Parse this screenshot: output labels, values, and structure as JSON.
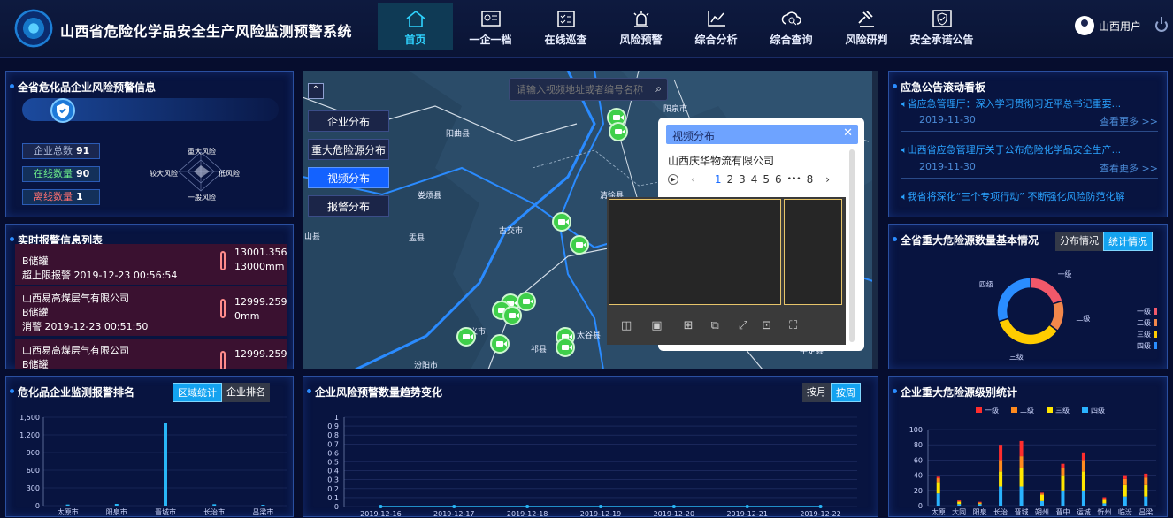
{
  "header": {
    "title": "山西省危险化学品安全生产风险监测预警系统",
    "user": "山西用户",
    "nav": [
      {
        "label": "首页"
      },
      {
        "label": "一企一档"
      },
      {
        "label": "在线巡查"
      },
      {
        "label": "风险预警"
      },
      {
        "label": "综合分析"
      },
      {
        "label": "综合查询"
      },
      {
        "label": "风险研判"
      },
      {
        "label": "安全承诺公告"
      }
    ]
  },
  "risk_panel": {
    "title": "全省危化品企业风险预警信息",
    "total_label": "企业总数",
    "total": "91",
    "online_label": "在线数量",
    "online": "90",
    "offline_label": "离线数量",
    "offline": "1",
    "radar": {
      "top": "重大风险",
      "right": "低风险",
      "bottom": "一般风险",
      "left": "较大风险"
    }
  },
  "alarm_panel": {
    "title": "实时报警信息列表",
    "rows": [
      {
        "company": "",
        "tank": "B储罐",
        "status": "超上限报警 2019-12-23 00:56:54",
        "value1": "13001.356",
        "value2": "13000mm"
      },
      {
        "company": "山西易高煤层气有限公司",
        "tank": "B储罐",
        "status": "消警 2019-12-23 00:51:50",
        "value1": "12999.259",
        "value2": "0mm"
      },
      {
        "company": "山西易高煤层气有限公司",
        "tank": "B储罐",
        "status": "",
        "value1": "12999.259",
        "value2": ""
      }
    ]
  },
  "map": {
    "search_placeholder": "请输入视频地址或者编号名称",
    "buttons": [
      "企业分布",
      "重大危险源分布",
      "视频分布",
      "报警分布"
    ],
    "places": [
      "阳曲县",
      "娄烦县",
      "古交市",
      "阳泉市",
      "清徐县",
      "太谷县",
      "祁县",
      "汾阳市",
      "孝义市",
      "盂县",
      "平定县",
      "山县"
    ]
  },
  "popup": {
    "title": "视频分布",
    "company": "山西庆华物流有限公司",
    "pages": [
      "1",
      "2",
      "3",
      "4",
      "5",
      "6",
      "•••",
      "8"
    ]
  },
  "notice_panel": {
    "title": "应急公告滚动看板",
    "items": [
      {
        "text": "省应急管理厅：深入学习贯彻习近平总书记重要...",
        "date": "2019-11-30",
        "more": "查看更多 >>"
      },
      {
        "text": "山西省应急管理厅关于公布危险化学品安全生产...",
        "date": "2019-11-30",
        "more": "查看更多 >>"
      },
      {
        "text": "我省将深化“三个专项行动” 不断强化风险防范化解",
        "date": "",
        "more": ""
      }
    ]
  },
  "hazard_panel": {
    "title": "全省重大危险源数量基本情况",
    "tabs": [
      "分布情况",
      "统计情况"
    ]
  },
  "rank_panel": {
    "title": "危化品企业监测报警排名",
    "tabs": [
      "区域统计",
      "企业排名"
    ]
  },
  "trend_panel": {
    "title": "企业风险预警数量趋势变化",
    "tabs": [
      "按月",
      "按周"
    ]
  },
  "level_panel": {
    "title": "企业重大危险源级别统计"
  },
  "chart_data": [
    {
      "type": "bar",
      "title": "危化品企业监测报警排名",
      "categories": [
        "太原市",
        "阳泉市",
        "晋城市",
        "长治市",
        "吕梁市"
      ],
      "values": [
        20,
        30,
        1400,
        25,
        15
      ],
      "ylim": [
        0,
        1500
      ],
      "yticks": [
        0,
        300,
        600,
        900,
        1200,
        1500
      ],
      "color": "#29b6f6"
    },
    {
      "type": "line",
      "title": "企业风险预警数量趋势变化",
      "x": [
        "2019-12-16",
        "2019-12-17",
        "2019-12-18",
        "2019-12-19",
        "2019-12-20",
        "2019-12-21",
        "2019-12-22"
      ],
      "values": [
        0,
        0,
        0,
        0,
        0,
        0,
        0
      ],
      "ylim": [
        0,
        1
      ],
      "yticks": [
        0,
        0.1,
        0.2,
        0.3,
        0.4,
        0.5,
        0.6,
        0.7,
        0.8,
        0.9,
        1
      ],
      "color": "#29b6f6"
    },
    {
      "type": "pie",
      "title": "全省重大危险源数量基本情况",
      "categories": [
        "一级",
        "二级",
        "三级",
        "四级"
      ],
      "values": [
        20,
        15,
        35,
        30
      ],
      "colors": [
        "#f2586a",
        "#f2874b",
        "#ffcc00",
        "#2a8dff"
      ]
    },
    {
      "type": "bar",
      "title": "企业重大危险源级别统计",
      "legend": [
        "一级",
        "二级",
        "三级",
        "四级"
      ],
      "colors": [
        "#ff2d2d",
        "#ff8a1e",
        "#ffe600",
        "#2ab3ff"
      ],
      "categories": [
        "太原",
        "大同",
        "阳泉",
        "长治",
        "晋城",
        "朔州",
        "晋中",
        "运城",
        "忻州",
        "临汾",
        "吕梁"
      ],
      "series": [
        {
          "name": "一级",
          "values": [
            2,
            1,
            1,
            20,
            20,
            1,
            5,
            10,
            2,
            5,
            5
          ]
        },
        {
          "name": "二级",
          "values": [
            5,
            1,
            1,
            15,
            15,
            2,
            10,
            15,
            2,
            8,
            10
          ]
        },
        {
          "name": "三级",
          "values": [
            15,
            3,
            1,
            20,
            25,
            8,
            20,
            25,
            4,
            15,
            15
          ]
        },
        {
          "name": "四级",
          "values": [
            16,
            2,
            2,
            25,
            25,
            6,
            20,
            20,
            3,
            12,
            12
          ]
        }
      ],
      "ylim": [
        0,
        100
      ],
      "yticks": [
        0,
        20,
        40,
        60,
        80,
        100
      ]
    }
  ]
}
